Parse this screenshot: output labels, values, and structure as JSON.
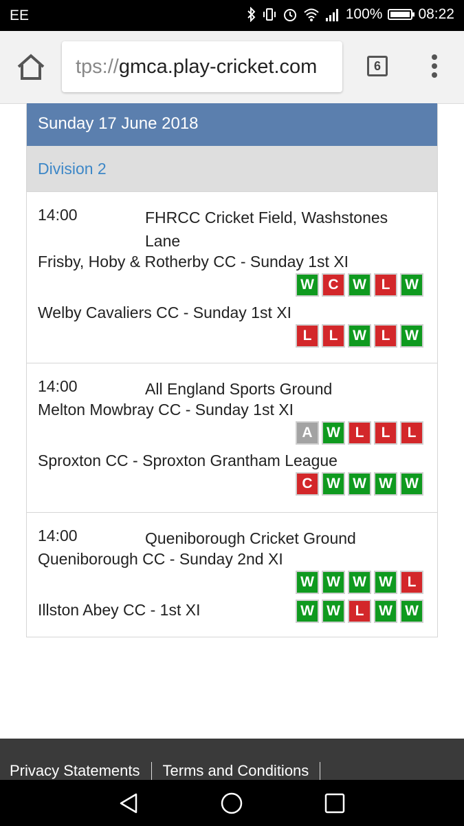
{
  "status_bar": {
    "carrier": "EE",
    "battery": "100%",
    "time": "08:22",
    "icons": [
      "bluetooth-icon",
      "vibrate-icon",
      "alarm-icon",
      "wifi-icon",
      "signal-icon",
      "battery-icon"
    ]
  },
  "browser": {
    "url_scheme": "tps://",
    "url_host": "gmca.play-cricket.com",
    "tab_count": "6"
  },
  "fixtures_panel": {
    "date": "Sunday 17 June 2018",
    "division": "Division 2",
    "fixtures": [
      {
        "time": "14:00",
        "venue": "FHRCC Cricket Field, Washstones Lane",
        "home": {
          "name": "Frisby, Hoby & Rotherby CC - Sunday 1st XI",
          "form": [
            "W",
            "C",
            "W",
            "L",
            "W"
          ]
        },
        "away": {
          "name": "Welby Cavaliers CC - Sunday 1st XI",
          "form": [
            "L",
            "L",
            "W",
            "L",
            "W"
          ]
        }
      },
      {
        "time": "14:00",
        "venue": "All England Sports Ground",
        "home": {
          "name": "Melton Mowbray CC - Sunday 1st XI",
          "form": [
            "A",
            "W",
            "L",
            "L",
            "L"
          ]
        },
        "away": {
          "name": "Sproxton CC - Sproxton Grantham League",
          "form": [
            "C",
            "W",
            "W",
            "W",
            "W"
          ]
        }
      },
      {
        "time": "14:00",
        "venue": "Queniborough Cricket Ground",
        "home": {
          "name": "Queniborough CC - Sunday 2nd XI",
          "form": [
            "W",
            "W",
            "W",
            "W",
            "L"
          ]
        },
        "away": {
          "name": "Illston Abey CC - 1st XI",
          "form": [
            "W",
            "W",
            "L",
            "W",
            "W"
          ]
        }
      }
    ]
  },
  "form_colors": {
    "W": "#0f9a1f",
    "L": "#d3272a",
    "C": "#d3272a",
    "A": "#a3a3a3"
  },
  "footer": {
    "privacy": "Privacy Statements",
    "terms": "Terms and Conditions"
  },
  "nav_bar": {
    "icons": [
      "back-icon",
      "home-circle-icon",
      "recents-icon"
    ]
  }
}
